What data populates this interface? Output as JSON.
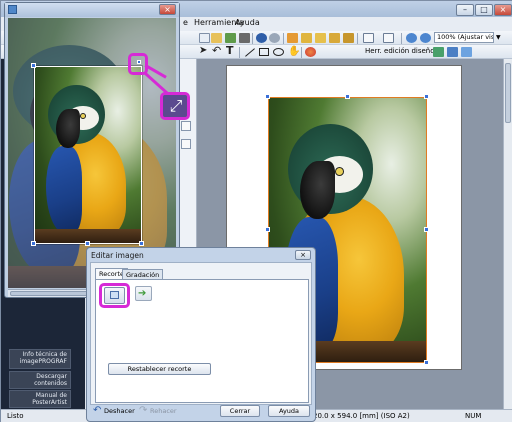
{
  "app": {
    "menu": [
      "e",
      "Herramienta",
      "Ayuda"
    ],
    "window_controls": {
      "minimize": "–",
      "maximize": "□",
      "close": "×"
    },
    "zoom": "100% (Ajustar vista)",
    "design_tools_label": "Herr. edición diseño"
  },
  "left_panel": {
    "buttons": [
      {
        "label": "Info técnica de imagePROGRAF"
      },
      {
        "label": "Descargar contenidos"
      },
      {
        "label": "Manual de PosterArtist"
      }
    ]
  },
  "status_bar": {
    "status": "Listo",
    "page_size": "20.0 x 594.0 [mm] (ISO A2)",
    "num": "NUM"
  },
  "trim_window": {
    "close": "×"
  },
  "edit_dialog": {
    "title": "Editar imagen",
    "close": "×",
    "tabs": [
      "Recorte",
      "Gradación"
    ],
    "reset_crop_label": "Restablecer recorte",
    "undo_label": "Deshacer",
    "redo_label": "Rehacer",
    "close_button_label": "Cerrar",
    "help_button_label": "Ayuda"
  },
  "colors": {
    "highlight": "#d62ad6",
    "handle": "#3a70d8",
    "crop_border": "#e07b22"
  },
  "icons": [
    "crop-icon",
    "arrow-right-icon",
    "undo-icon",
    "redo-icon",
    "rotate-icon",
    "text-icon",
    "line-icon",
    "rectangle-icon",
    "ellipse-icon",
    "hand-icon",
    "zoom-in-icon",
    "zoom-out-icon",
    "resize-diagonal-icon"
  ]
}
